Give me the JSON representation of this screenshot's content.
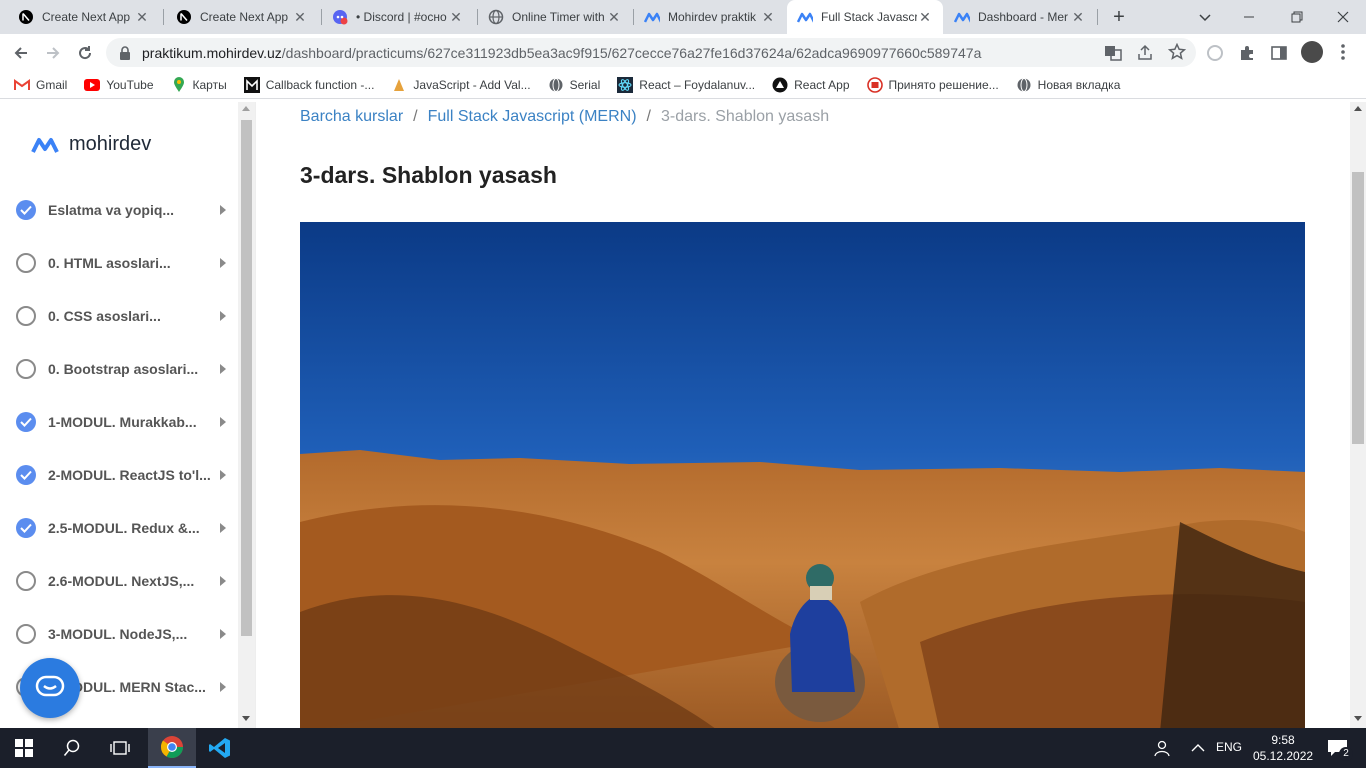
{
  "browser": {
    "tabs": [
      {
        "title": "Create Next App",
        "icon": "nextjs-icon",
        "active": false
      },
      {
        "title": "Create Next App",
        "icon": "nextjs-icon",
        "active": false
      },
      {
        "title": "• Discord | #осно",
        "icon": "discord-icon",
        "active": false
      },
      {
        "title": "Online Timer with",
        "icon": "globe-icon",
        "active": false
      },
      {
        "title": "Mohirdev praktik",
        "icon": "mohirdev-icon",
        "active": false
      },
      {
        "title": "Full Stack Javascr",
        "icon": "mohirdev-icon",
        "active": true
      },
      {
        "title": "Dashboard - Mer",
        "icon": "mohirdev-icon",
        "active": false
      }
    ],
    "url_host": "praktikum.mohirdev.uz",
    "url_path": "/dashboard/practicums/627ce311923db5ea3ac9f915/627cecce76a27fe16d37624a/62adca9690977660c589747a",
    "bookmarks": [
      {
        "label": "Gmail",
        "icon": "gmail-icon",
        "color": "#ea4335"
      },
      {
        "label": "YouTube",
        "icon": "youtube-icon",
        "color": "#ff0000"
      },
      {
        "label": "Карты",
        "icon": "maps-icon",
        "color": "#34a853"
      },
      {
        "label": "Callback function -...",
        "icon": "m-icon",
        "color": "#111111"
      },
      {
        "label": "JavaScript - Add Val...",
        "icon": "js-icon",
        "color": "#e6a23c"
      },
      {
        "label": "Serial",
        "icon": "globe-icon",
        "color": "#5f6368"
      },
      {
        "label": "React – Foydalanuv...",
        "icon": "react-icon",
        "color": "#1b2a3a"
      },
      {
        "label": "React App",
        "icon": "react-app-icon",
        "color": "#111111"
      },
      {
        "label": "Принято решение...",
        "icon": "news-icon",
        "color": "#d93025"
      },
      {
        "label": "Новая вкладка",
        "icon": "globe-icon",
        "color": "#5f6368"
      }
    ]
  },
  "sidebar": {
    "logo_text": "mohirdev",
    "modules": [
      {
        "label": "Eslatma va yopiq...",
        "done": true
      },
      {
        "label": "0. HTML asoslari...",
        "done": false
      },
      {
        "label": "0. CSS asoslari...",
        "done": false
      },
      {
        "label": "0. Bootstrap asoslari...",
        "done": false
      },
      {
        "label": "1-MODUL. Murakkab...",
        "done": true
      },
      {
        "label": "2-MODUL. ReactJS to'l...",
        "done": true
      },
      {
        "label": "2.5-MODUL. Redux &...",
        "done": true
      },
      {
        "label": "2.6-MODUL. NextJS,...",
        "done": false
      },
      {
        "label": "3-MODUL. NodeJS,...",
        "done": false
      },
      {
        "label": "4-MODUL. MERN Stac...",
        "done": false
      }
    ]
  },
  "breadcrumb": {
    "items": [
      "Barcha kurslar",
      "Full Stack Javascript (MERN)"
    ],
    "current": "3-dars. Shablon yasash"
  },
  "lesson": {
    "title": "3-dars. Shablon yasash"
  },
  "taskbar": {
    "lang": "ENG",
    "time": "9:58",
    "date": "05.12.2022",
    "notifications": "2"
  },
  "colors": {
    "accent": "#5b8def",
    "link": "#3b82c4",
    "chat": "#2b7be0"
  }
}
